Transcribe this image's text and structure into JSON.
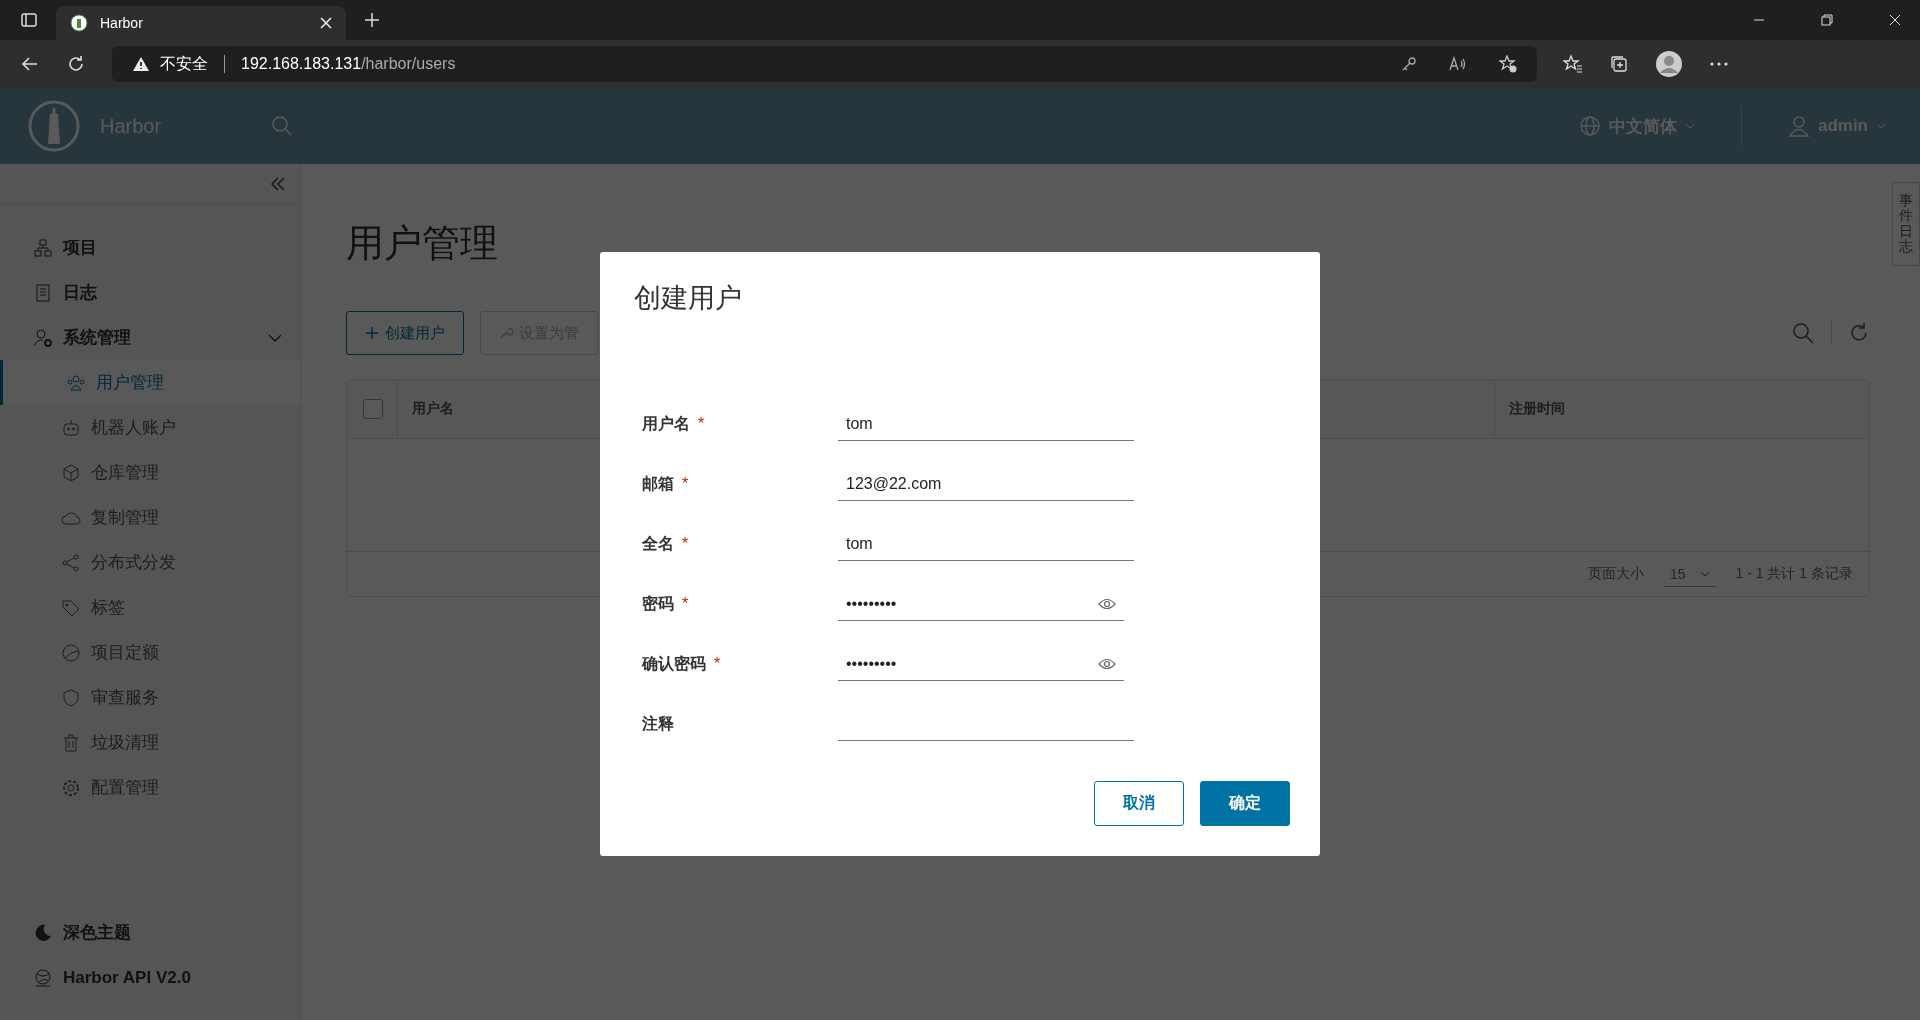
{
  "browser": {
    "tab_title": "Harbor",
    "security_label": "不安全",
    "url_host": "192.168.183.131",
    "url_path": "/harbor/users"
  },
  "header": {
    "brand": "Harbor",
    "language": "中文简体",
    "user": "admin"
  },
  "sidebar": {
    "items": [
      {
        "label": "项目",
        "selected": false
      },
      {
        "label": "日志",
        "selected": false
      },
      {
        "label": "系统管理",
        "selected": false,
        "expanded": true,
        "children": [
          {
            "label": "用户管理",
            "selected": true
          },
          {
            "label": "机器人账户",
            "selected": false
          },
          {
            "label": "仓库管理",
            "selected": false
          },
          {
            "label": "复制管理",
            "selected": false
          },
          {
            "label": "分布式分发",
            "selected": false
          },
          {
            "label": "标签",
            "selected": false
          },
          {
            "label": "项目定额",
            "selected": false
          },
          {
            "label": "审查服务",
            "selected": false
          },
          {
            "label": "垃圾清理",
            "selected": false
          },
          {
            "label": "配置管理",
            "selected": false
          }
        ]
      }
    ],
    "footer_items": [
      "深色主题",
      "Harbor API V2.0"
    ]
  },
  "page": {
    "title": "用户管理",
    "actions": [
      {
        "label": "创建用户",
        "disabled": false
      },
      {
        "label": "设置为管",
        "disabled": true
      }
    ],
    "table": {
      "select_all": {
        "checked": false
      },
      "columns": [
        "用户名",
        "注册时间"
      ]
    },
    "footer": {
      "page_size_label": "页面大小",
      "page_size": "15",
      "summary": "1 - 1 共计 1 条记录"
    }
  },
  "side_tab": "事件日志",
  "dialog": {
    "title": "创建用户",
    "fields": [
      {
        "label": "用户名",
        "required_mark": "*",
        "kind": "text",
        "value": "tom"
      },
      {
        "label": "邮箱",
        "required_mark": "*",
        "kind": "text",
        "value": "123@22.com"
      },
      {
        "label": "全名",
        "required_mark": "*",
        "kind": "text",
        "value": "tom"
      },
      {
        "label": "密码",
        "required_mark": "*",
        "kind": "password",
        "value": "•••••••••"
      },
      {
        "label": "确认密码",
        "required_mark": "*",
        "kind": "password",
        "value": "•••••••••"
      },
      {
        "label": "注释",
        "kind": "text"
      }
    ],
    "buttons": [
      {
        "label": "取消",
        "kind": "secondary"
      },
      {
        "label": "确定",
        "kind": "primary"
      }
    ]
  }
}
